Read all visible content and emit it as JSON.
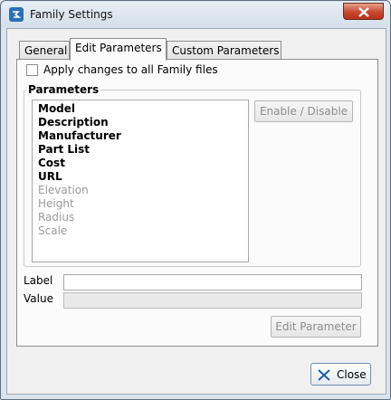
{
  "window": {
    "title": "Family Settings"
  },
  "tabs": [
    {
      "label": "General"
    },
    {
      "label": "Edit Parameters"
    },
    {
      "label": "Custom Parameters"
    }
  ],
  "apply_all": {
    "label": "Apply changes to all Family files",
    "checked": false
  },
  "parameters": {
    "legend": "Parameters",
    "items": [
      {
        "label": "Model",
        "enabled": true
      },
      {
        "label": "Description",
        "enabled": true
      },
      {
        "label": "Manufacturer",
        "enabled": true
      },
      {
        "label": "Part List",
        "enabled": true
      },
      {
        "label": "Cost",
        "enabled": true
      },
      {
        "label": "URL",
        "enabled": true
      },
      {
        "label": "Elevation",
        "enabled": false
      },
      {
        "label": "Height",
        "enabled": false
      },
      {
        "label": "Radius",
        "enabled": false
      },
      {
        "label": "Scale",
        "enabled": false
      }
    ],
    "toggle_button": "Enable / Disable"
  },
  "fields": {
    "label": {
      "caption": "Label",
      "value": ""
    },
    "value": {
      "caption": "Value",
      "value": ""
    }
  },
  "edit_button": "Edit Parameter",
  "close_button": "Close",
  "colors": {
    "accent": "#2a6fb5",
    "close_red": "#c8472d",
    "disabled_text": "#9a9a9a"
  }
}
